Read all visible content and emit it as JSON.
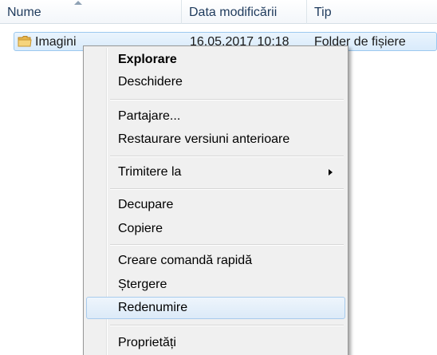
{
  "columns": {
    "name": "Nume",
    "date": "Data modificării",
    "type": "Tip"
  },
  "file": {
    "name": "Imagini",
    "date": "16.05.2017 10:18",
    "type": "Folder de fișiere",
    "icon": "folder-icon"
  },
  "menu": {
    "explore": "Explorare",
    "open": "Deschidere",
    "share": "Partajare...",
    "restore": "Restaurare versiuni anterioare",
    "send_to": "Trimitere la",
    "cut": "Decupare",
    "copy": "Copiere",
    "shortcut": "Creare comandă rapidă",
    "delete": "Ștergere",
    "rename": "Redenumire",
    "properties": "Proprietăți"
  },
  "colors": {
    "selection": "#d9ebfb",
    "selection_border": "#9cc9ef",
    "menu_background": "#f0f0f0"
  }
}
